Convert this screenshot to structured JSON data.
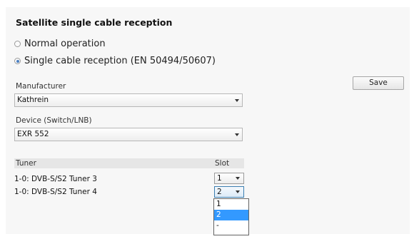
{
  "title": "Satellite single cable reception",
  "radios": [
    {
      "label": "Normal operation",
      "checked": false
    },
    {
      "label": "Single cable reception (EN 50494/50607)",
      "checked": true
    }
  ],
  "manufacturer": {
    "label": "Manufacturer",
    "value": "Kathrein"
  },
  "device": {
    "label": "Device (Switch/LNB)",
    "value": "EXR 552"
  },
  "save_label": "Save",
  "tuner_table": {
    "headers": {
      "tuner": "Tuner",
      "slot": "Slot"
    },
    "rows": [
      {
        "tuner": "1-0: DVB-S/S2 Tuner 3",
        "slot": "1"
      },
      {
        "tuner": "1-0: DVB-S/S2 Tuner 4",
        "slot": "2"
      }
    ]
  },
  "slot_dropdown": {
    "options": [
      "1",
      "2",
      "-"
    ],
    "selected": "2"
  },
  "colors": {
    "highlight": "#3399ff",
    "radio_dot": "#4a7fc1",
    "focus_border": "#3c7fb1"
  }
}
